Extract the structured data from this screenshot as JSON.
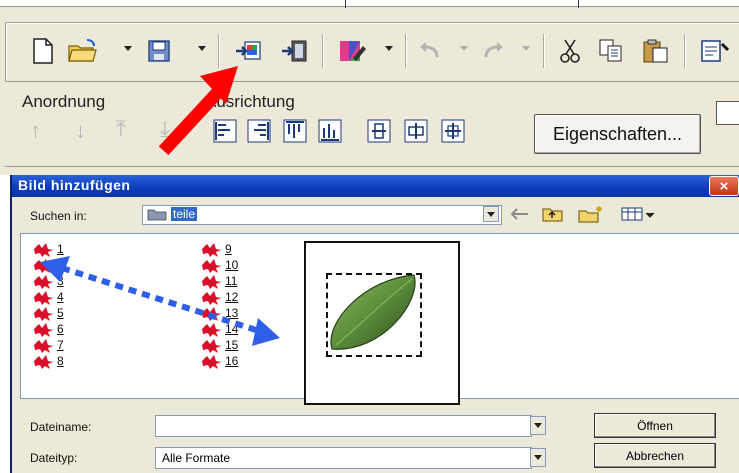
{
  "toolbar": {
    "anordnung_label": "Anordnung",
    "ausrichtung_label": "Ausrichtung",
    "eigenschaften_label": "Eigenschaften..."
  },
  "dialog": {
    "title": "Bild hinzufügen",
    "close_symbol": "×",
    "look_in_label": "Suchen in:",
    "look_in_value": "teile",
    "file_name_label": "Dateiname:",
    "file_name_value": "",
    "file_type_label": "Dateityp:",
    "file_type_value": "Alle Formate",
    "open_label": "Öffnen",
    "cancel_label": "Abbrechen",
    "files_col1": [
      "1",
      "2",
      "3",
      "4",
      "5",
      "6",
      "7",
      "8"
    ],
    "files_col2": [
      "9",
      "10",
      "11",
      "12",
      "13",
      "14",
      "15",
      "16"
    ]
  },
  "colors": {
    "annotation_red": "#ff0000",
    "annotation_blue": "#2f5fe8",
    "title_blue": "#0b3bb8"
  }
}
